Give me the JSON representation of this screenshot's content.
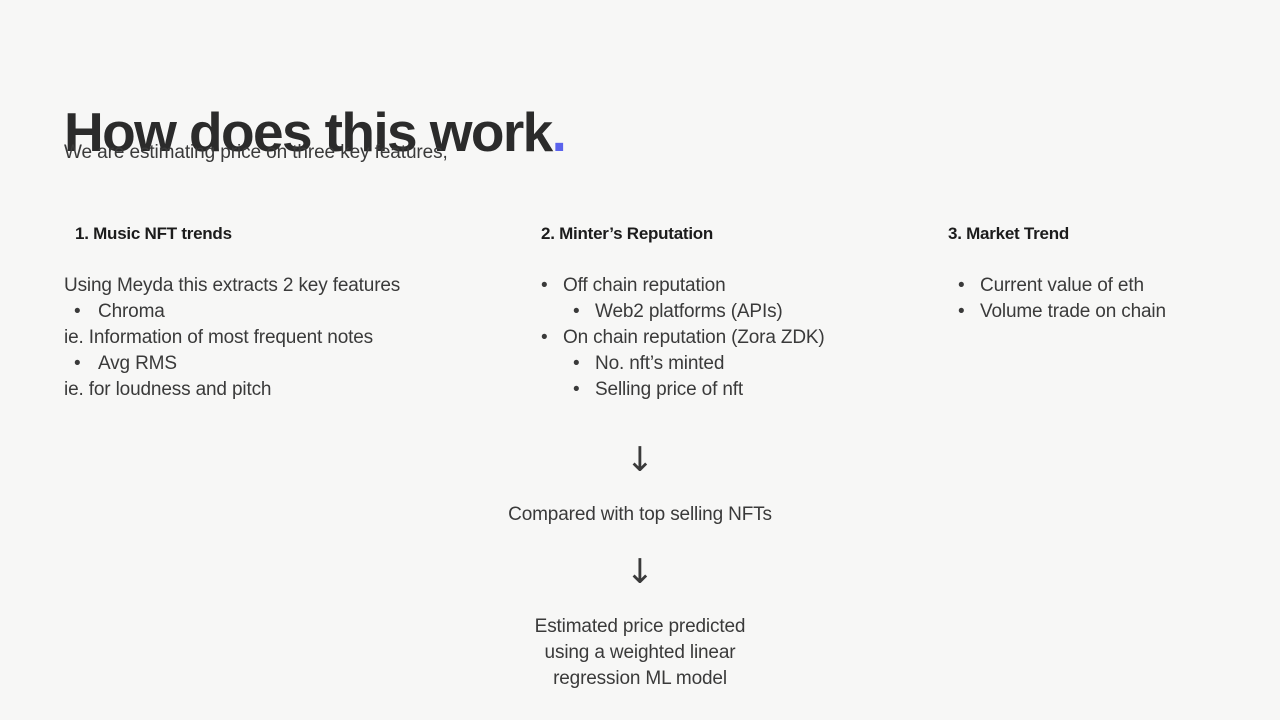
{
  "header": {
    "title": "How does this work",
    "title_dot": ".",
    "subtitle": "We are estimating price on three key features,"
  },
  "columns": [
    {
      "heading": "1. Music NFT trends",
      "lines": [
        {
          "kind": "text",
          "level": 0,
          "text": "Using Meyda this extracts 2 key features"
        },
        {
          "kind": "bullet",
          "level": 1,
          "bullet": "•",
          "text": "Chroma"
        },
        {
          "kind": "text",
          "level": 0,
          "text": "ie. Information of most frequent notes"
        },
        {
          "kind": "bullet",
          "level": 1,
          "bullet": "•",
          "text": "Avg RMS"
        },
        {
          "kind": "text",
          "level": 0,
          "text": "ie. for loudness and pitch"
        }
      ]
    },
    {
      "heading": "2. Minter’s Reputation",
      "lines": [
        {
          "kind": "bullet",
          "level": 0,
          "bullet": "•",
          "text": "Off chain reputation"
        },
        {
          "kind": "bullet",
          "level": 2,
          "bullet": "•",
          "text": "Web2 platforms (APIs)"
        },
        {
          "kind": "bullet",
          "level": 0,
          "bullet": "•",
          "text": "On chain reputation (Zora ZDK)"
        },
        {
          "kind": "bullet",
          "level": 2,
          "bullet": "•",
          "text": "No. nft’s minted"
        },
        {
          "kind": "bullet",
          "level": 2,
          "bullet": "•",
          "text": "Selling price of nft"
        }
      ]
    },
    {
      "heading": "3. Market Trend",
      "lines": [
        {
          "kind": "bullet",
          "level": 3,
          "bullet": "•",
          "text": "Current value of eth"
        },
        {
          "kind": "bullet",
          "level": 3,
          "bullet": "•",
          "text": "Volume trade on chain"
        }
      ]
    }
  ],
  "flow": {
    "arrow_1": "↓",
    "step_1": "Compared with top selling NFTs",
    "arrow_2": "↓",
    "step_2_lines": [
      "Estimated price predicted",
      "using a weighted linear",
      "regression ML model"
    ]
  },
  "colors": {
    "background": "#f7f7f6",
    "title": "#2b2b2b",
    "accent_dot": "#5b63ec",
    "body_text": "#3a3a3a",
    "heading_text": "#1c1c1c"
  }
}
